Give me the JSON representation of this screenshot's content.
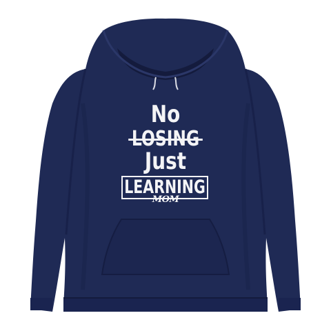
{
  "garment": {
    "type": "pullover hoodie",
    "color": "#1f2a55",
    "shadow_color": "#141b3d",
    "highlight_color": "#2b3768",
    "print_color": "#f4f4f6"
  },
  "print": {
    "line1": "No",
    "line2": "LOSING",
    "line3": "Just",
    "line4": "LEARNING",
    "logo": "MOM"
  }
}
